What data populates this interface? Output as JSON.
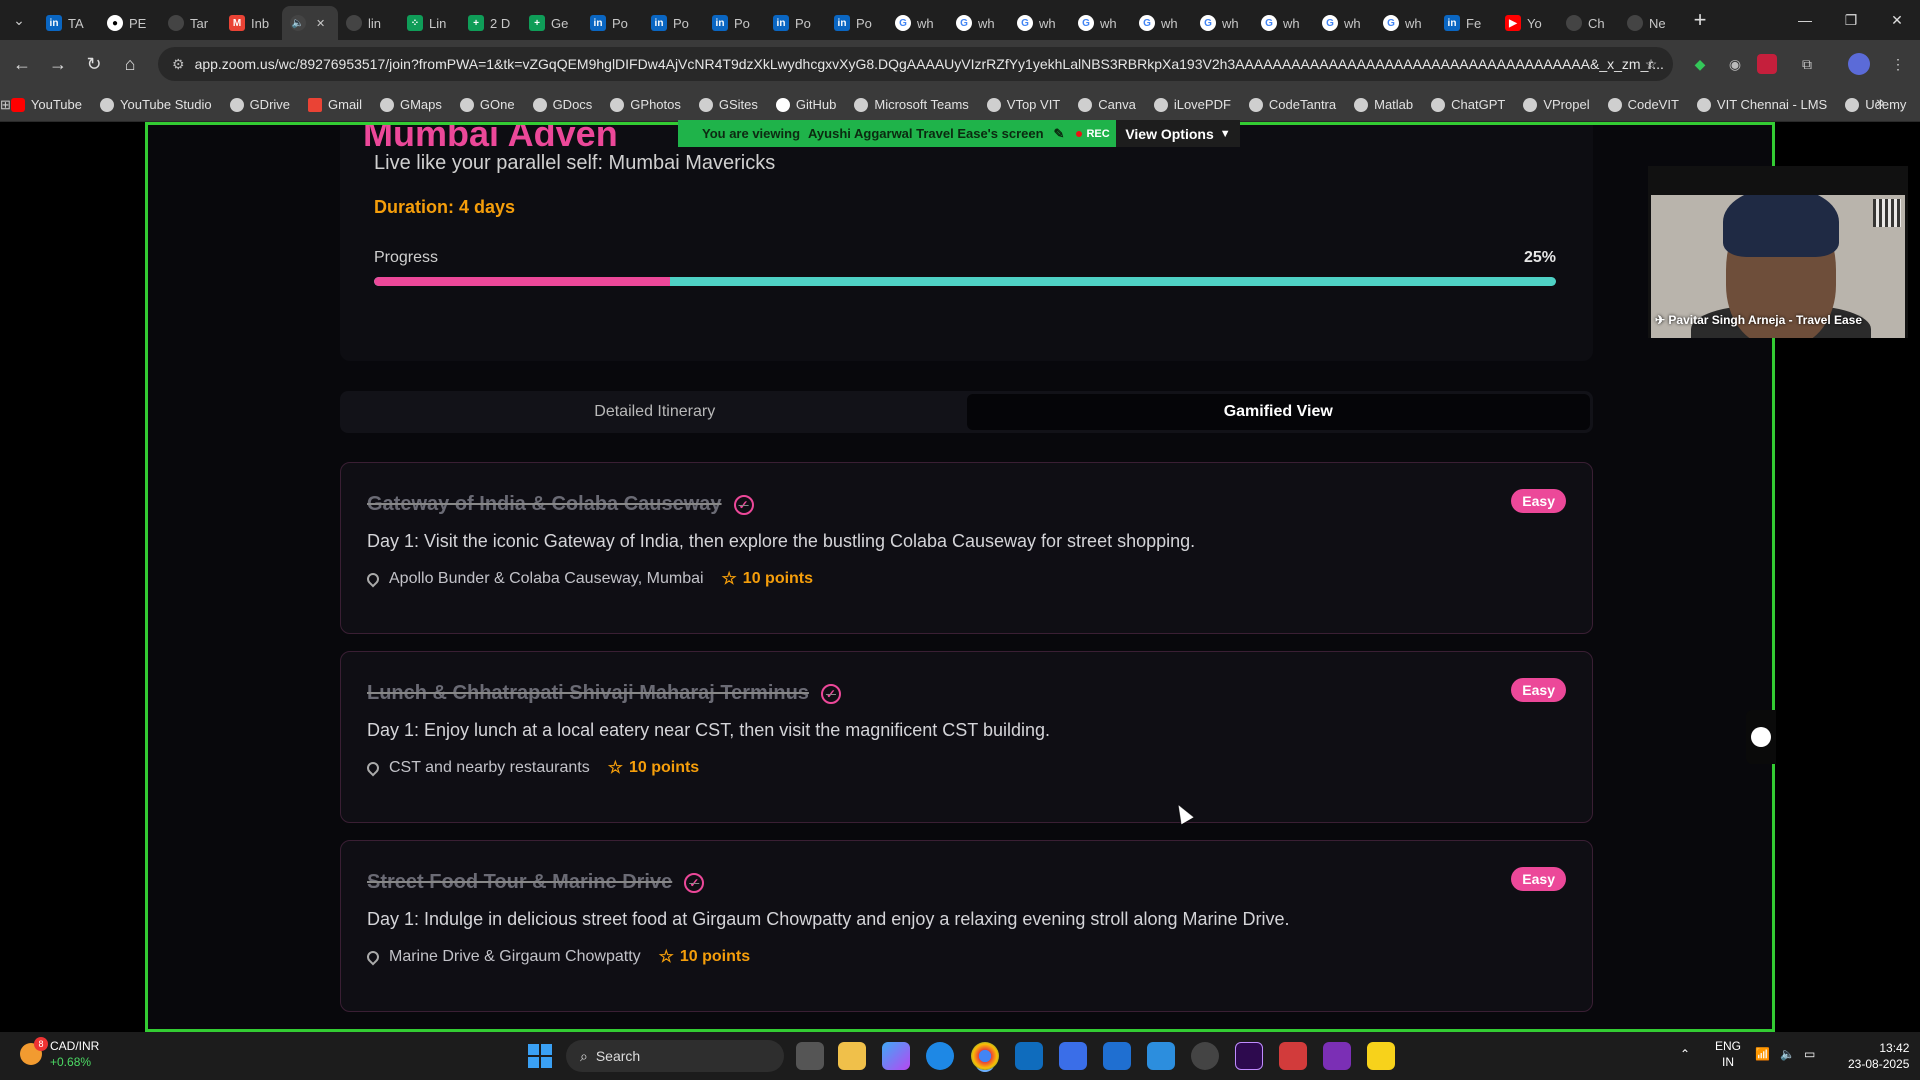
{
  "browser": {
    "tabs": [
      {
        "label": "TA",
        "icon": "linkedin-icon"
      },
      {
        "label": "PE",
        "icon": "github-icon"
      },
      {
        "label": "Tar",
        "icon": "globe-icon"
      },
      {
        "label": "Inb",
        "icon": "gmail-icon"
      },
      {
        "label": "",
        "icon": "speaker-icon",
        "active": true
      },
      {
        "label": "lin",
        "icon": "globe-icon"
      },
      {
        "label": "Lin",
        "icon": "dots-icon"
      },
      {
        "label": "2 D",
        "icon": "sheets-icon"
      },
      {
        "label": "Ge",
        "icon": "sheets-icon"
      },
      {
        "label": "Po",
        "icon": "linkedin-icon"
      },
      {
        "label": "Po",
        "icon": "linkedin-icon"
      },
      {
        "label": "Po",
        "icon": "linkedin-icon"
      },
      {
        "label": "Po",
        "icon": "linkedin-icon"
      },
      {
        "label": "Po",
        "icon": "linkedin-icon"
      },
      {
        "label": "wh",
        "icon": "google-icon"
      },
      {
        "label": "wh",
        "icon": "google-icon"
      },
      {
        "label": "wh",
        "icon": "google-icon"
      },
      {
        "label": "wh",
        "icon": "google-icon"
      },
      {
        "label": "wh",
        "icon": "google-icon"
      },
      {
        "label": "wh",
        "icon": "google-icon"
      },
      {
        "label": "wh",
        "icon": "google-icon"
      },
      {
        "label": "wh",
        "icon": "google-icon"
      },
      {
        "label": "wh",
        "icon": "google-icon"
      },
      {
        "label": "Fe",
        "icon": "linkedin-icon"
      },
      {
        "label": "Yo",
        "icon": "youtube-icon"
      },
      {
        "label": "Ch",
        "icon": "openai-icon"
      },
      {
        "label": "Ne",
        "icon": "openai-icon"
      }
    ],
    "url": "app.zoom.us/wc/89276953517/join?fromPWA=1&tk=vZGqQEM9hglDIFDw4AjVcNR4T9dzXkLwydhcgxvXyG8.DQgAAAAUyVIzrRZfYy1yekhLalNBS3RBRkpXa193V2h3AAAAAAAAAAAAAAAAAAAAAAAAAAAAAAAAAAAAAA&_x_zm_r...",
    "bookmarks": [
      "YouTube",
      "YouTube Studio",
      "GDrive",
      "Gmail",
      "GMaps",
      "GOne",
      "GDocs",
      "GPhotos",
      "GSites",
      "GitHub",
      "Microsoft Teams",
      "VTop VIT",
      "Canva",
      "iLovePDF",
      "CodeTantra",
      "Matlab",
      "ChatGPT",
      "VPropel",
      "CodeVIT",
      "VIT Chennai - LMS",
      "Udemy"
    ]
  },
  "zoom": {
    "banner_prefix": "You are viewing",
    "banner_name": "Ayushi Aggarwal Travel Ease's screen",
    "rec_label": "REC",
    "view_options": "View Options",
    "participant_name": "Pavitar Singh Arneja - Travel Ease",
    "accent_color": "#33cc33"
  },
  "trip": {
    "title_partial": "Mumbai Adven",
    "subtitle": "Live like your parallel self: Mumbai Mavericks",
    "duration": "Duration: 4 days",
    "progress_label": "Progress",
    "progress_pct_text": "25%",
    "progress_value": 0.25,
    "tabs": [
      "Detailed Itinerary",
      "Gamified View"
    ],
    "active_tab": "Gamified View",
    "activities": [
      {
        "title": "Gateway of India & Colaba Causeway",
        "difficulty": "Easy",
        "description": "Day 1: Visit the iconic Gateway of India, then explore the bustling Colaba Causeway for street shopping.",
        "location": "Apollo Bunder & Colaba Causeway, Mumbai",
        "points": "10 points",
        "completed": true
      },
      {
        "title": "Lunch & Chhatrapati Shivaji Maharaj Terminus",
        "difficulty": "Easy",
        "description": "Day 1: Enjoy lunch at a local eatery near CST, then visit the magnificent CST building.",
        "location": "CST and nearby restaurants",
        "points": "10 points",
        "completed": true
      },
      {
        "title": "Street Food Tour & Marine Drive",
        "difficulty": "Easy",
        "description": "Day 1: Indulge in delicious street food at Girgaum Chowpatty and enjoy a relaxing evening stroll along Marine Drive.",
        "location": "Marine Drive & Girgaum Chowpatty",
        "points": "10 points",
        "completed": true
      }
    ],
    "colors": {
      "primary": "#ec4899",
      "secondary": "#4fd1c5",
      "points": "#f59e0b"
    }
  },
  "taskbar": {
    "weather_title": "CAD/INR",
    "weather_sub": "+0.68%",
    "weather_badge": "8",
    "search_placeholder": "Search",
    "lang_1": "ENG",
    "lang_2": "IN",
    "time": "13:42",
    "date": "23-08-2025"
  }
}
